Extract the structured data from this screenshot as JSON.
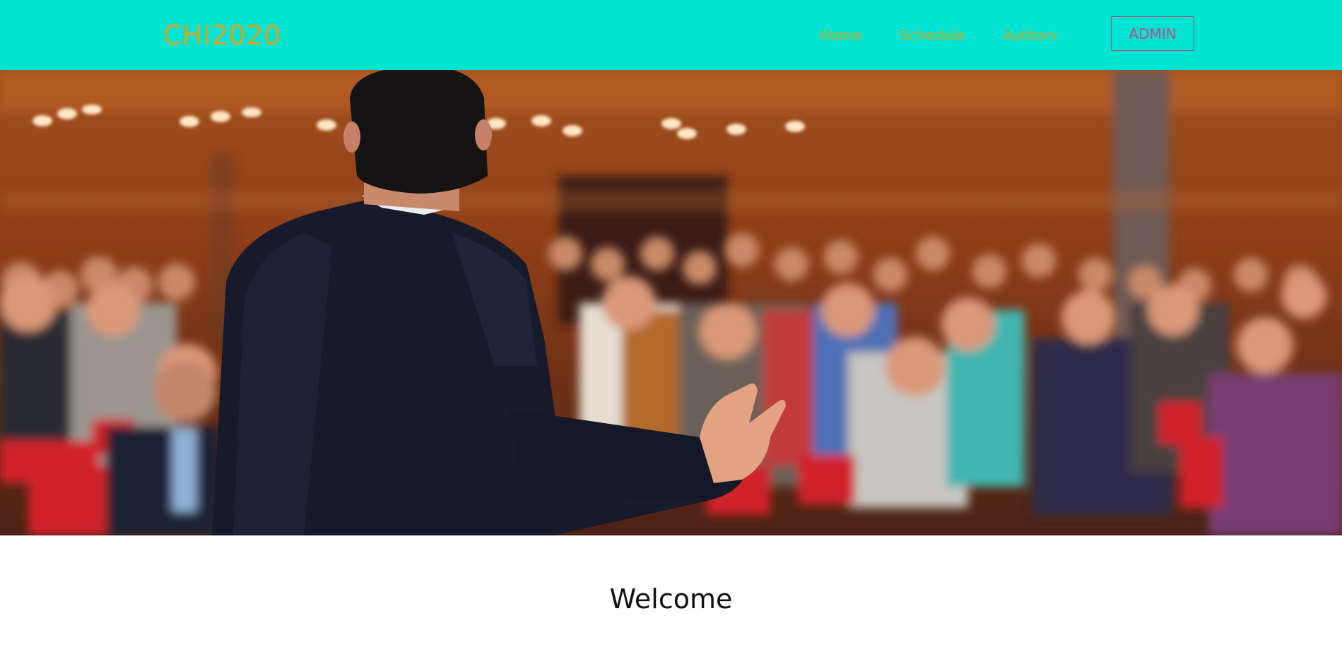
{
  "header": {
    "brand": "CHI2020",
    "nav": [
      {
        "label": "Home"
      },
      {
        "label": "Schedule"
      },
      {
        "label": "Authors"
      }
    ],
    "admin_label": "ADMIN"
  },
  "hero": {
    "image": "conference-audience-speaker-photo"
  },
  "main": {
    "title": "Welcome"
  },
  "colors": {
    "navbar_bg": "#00e5d3",
    "brand_text": "#d9a21b",
    "nav_text": "#c9a21e",
    "admin_border": "#b04a7a",
    "admin_text": "#c04a86"
  }
}
